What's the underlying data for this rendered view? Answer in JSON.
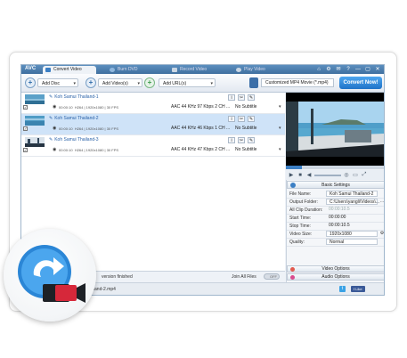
{
  "app": {
    "logo": "AVC",
    "tabs": [
      {
        "label": "Convert Video",
        "active": true,
        "icon": "convert-video-icon"
      },
      {
        "label": "Burn DVD",
        "active": false,
        "icon": "burn-dvd-icon"
      },
      {
        "label": "Record Video",
        "active": false,
        "icon": "record-video-icon"
      },
      {
        "label": "Play Video",
        "active": false,
        "icon": "play-video-icon"
      }
    ],
    "window_buttons": [
      "⌂",
      "⚙",
      "✉",
      "?",
      "—",
      "▢",
      "✕"
    ]
  },
  "toolbar": {
    "add_disc": "Add Disc",
    "add_videos": "Add Video(s)",
    "add_urls": "Add URL(s)",
    "profile": "Customized MP4 Movie (*.mp4)",
    "convert": "Convert Now!"
  },
  "files": [
    {
      "name": "Koh Samui Thailand-1",
      "selected": false,
      "duration": "00:00:10",
      "info": "H264 | 1920x1080 | 30 FPS",
      "audio": "AAC 44 KHz 97 Kbps 2 CH ...",
      "subtitle": "No Subtitle"
    },
    {
      "name": "Koh Samui Thailand-2",
      "selected": true,
      "duration": "00:00:10",
      "info": "H264 | 1920x1080 | 30 FPS",
      "audio": "AAC 44 KHz 46 Kbps 1 CH ...",
      "subtitle": "No Subtitle"
    },
    {
      "name": "Koh Samui Thailand-3",
      "selected": false,
      "duration": "00:00:10",
      "info": "H264 | 1920x1080 | 30 FPS",
      "audio": "AAC 44 KHz 47 Kbps 2 CH ...",
      "subtitle": "No Subtitle"
    }
  ],
  "status": {
    "message": "version finished",
    "join_label": "Join All Files",
    "join_state": "OFF"
  },
  "bottom": {
    "output_path": "ui Thailand-2.mp4",
    "like": "Like"
  },
  "settings": {
    "title": "Basic Settings",
    "rows": [
      {
        "label": "File Name:",
        "value": "Koh Samui Thailand-2",
        "style": "box"
      },
      {
        "label": "Output Folder:",
        "value": "C:\\Users\\yangli\\Videos\\...",
        "style": "box",
        "button": "…"
      },
      {
        "label": "All Clip Duration:",
        "value": "00:00:10.5",
        "style": "dim"
      },
      {
        "label": "Start Time:",
        "value": "00:00:00",
        "style": "plain"
      },
      {
        "label": "Stop Time:",
        "value": "00:00:10.5",
        "style": "plain"
      },
      {
        "label": "Video Size:",
        "value": "1920x1080",
        "style": "box",
        "button": "⚙"
      },
      {
        "label": "Quality:",
        "value": "Normal",
        "style": "box"
      }
    ],
    "video_options": "Video Options",
    "audio_options": "Audio Options"
  }
}
